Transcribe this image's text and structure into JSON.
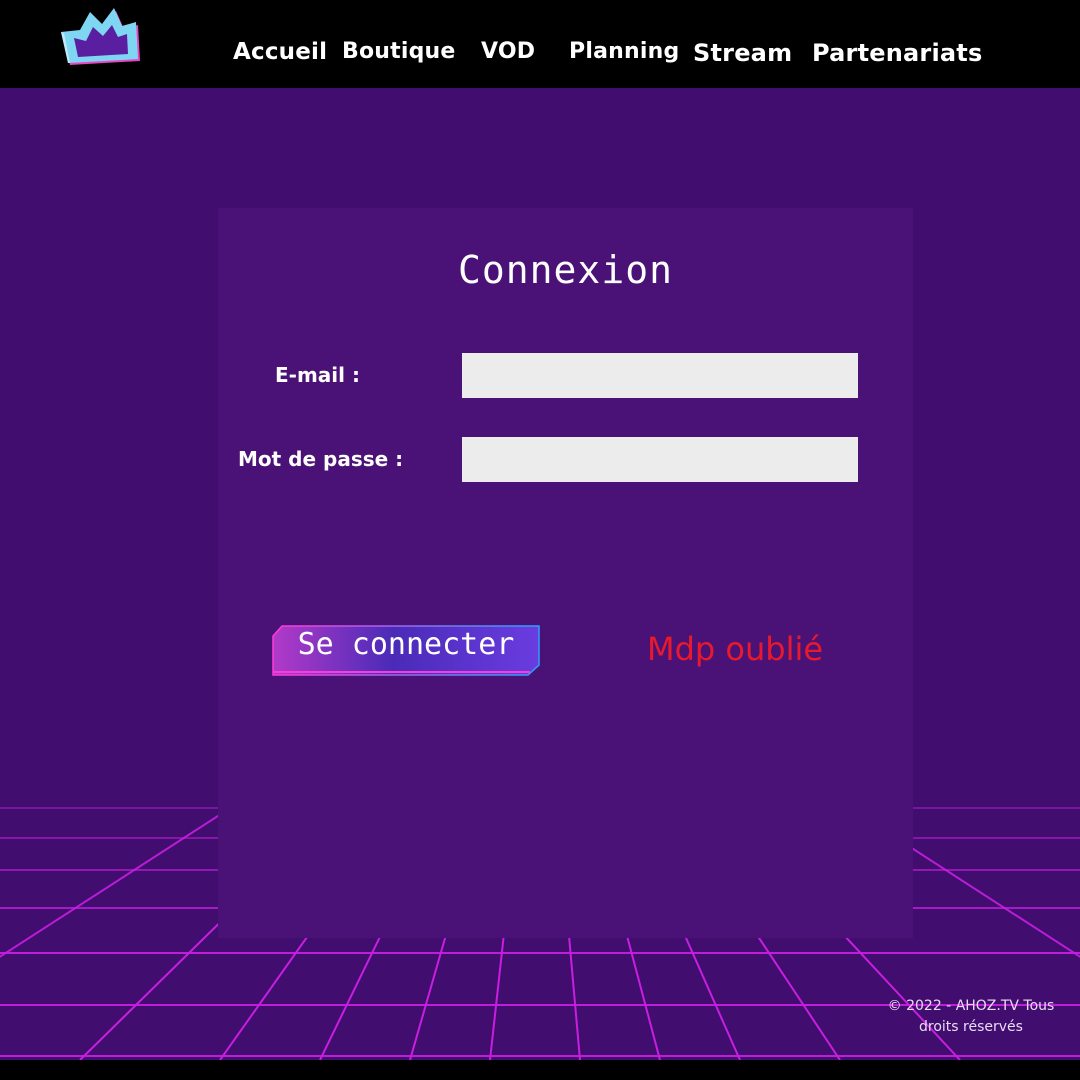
{
  "header": {
    "logo_icon": "crown-icon",
    "nav": [
      {
        "label": "Accueil"
      },
      {
        "label": "Boutique"
      },
      {
        "label": "VOD"
      },
      {
        "label": "Planning"
      },
      {
        "label": "Stream"
      },
      {
        "label": "Partenariats"
      }
    ]
  },
  "login": {
    "title": "Connexion",
    "email_label": "E-mail :",
    "email_value": "",
    "password_label": "Mot de passe :",
    "password_value": "",
    "submit_label": "Se connecter",
    "forgot_label": "Mdp oublié"
  },
  "footer": {
    "copyright_line1": "© 2022 - AHOZ.TV Tous",
    "copyright_line2": "droits réservés"
  },
  "colors": {
    "background": "#410e6f",
    "panel": "#4a1276",
    "grid": "#c81ee0",
    "forgot_link": "#e8192c",
    "input_bg": "#ececec",
    "header": "#000000"
  }
}
